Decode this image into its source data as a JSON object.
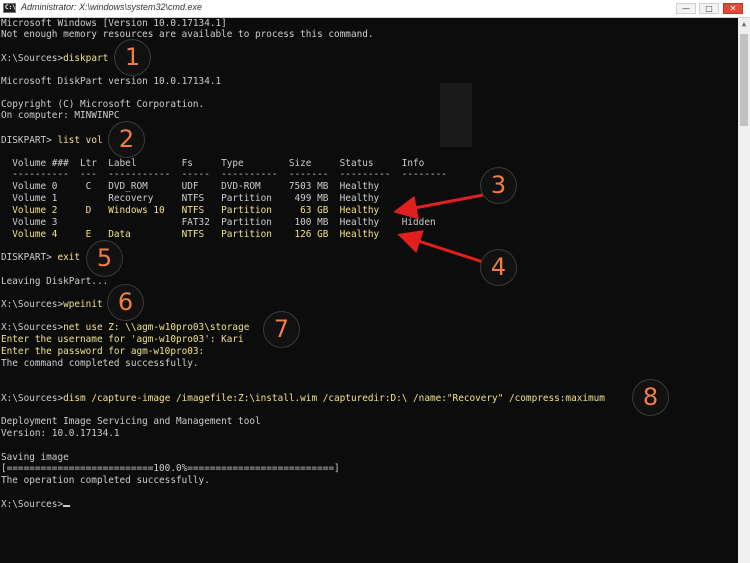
{
  "window": {
    "title": "Administrator: X:\\windows\\system32\\cmd.exe",
    "icon_label": "C:\\",
    "buttons": [
      "minimize",
      "maximize",
      "close"
    ]
  },
  "console": {
    "lines": {
      "l1": "Microsoft Windows [Version 10.0.17134.1]",
      "l2": "Not enough memory resources are available to process this command.",
      "prompt1": "X:\\Sources>",
      "cmd1": "diskpart",
      "l4": "Microsoft DiskPart version 10.0.17134.1",
      "l5": "Copyright (C) Microsoft Corporation.",
      "l6": "On computer: MINWINPC",
      "prompt2": "DISKPART> ",
      "cmd2": "list vol",
      "th": "  Volume ###  Ltr  Label        Fs     Type        Size     Status     Info",
      "tsep": "  ----------  ---  -----------  -----  ----------  -------  ---------  --------",
      "v0": "  Volume 0     C   DVD_ROM      UDF    DVD-ROM     7503 MB  Healthy",
      "v1": "  Volume 1         Recovery     NTFS   Partition    499 MB  Healthy",
      "v2": "  Volume 2     D   Windows 10   NTFS   Partition     63 GB  Healthy",
      "v3": "  Volume 3                      FAT32  Partition    100 MB  Healthy    Hidden",
      "v4": "  Volume 4     E   Data         NTFS   Partition    126 GB  Healthy",
      "prompt3": "DISKPART> ",
      "cmd3": "exit",
      "l7": "Leaving DiskPart...",
      "prompt4": "X:\\Sources>",
      "cmd4": "wpeinit",
      "prompt5": "X:\\Sources>",
      "cmd5": "net use Z: \\\\agm-w10pro03\\storage",
      "l8": "Enter the username for 'agm-w10pro03': Kari",
      "l9": "Enter the password for agm-w10pro03:",
      "l10": "The command completed successfully.",
      "prompt6": "X:\\Sources>",
      "cmd6": "dism /capture-image /imagefile:Z:\\install.wim /capturedir:D:\\ /name:\"Recovery\" /compress:maximum",
      "l11": "Deployment Image Servicing and Management tool",
      "l12": "Version: 10.0.17134.1",
      "l13": "Saving image",
      "l14": "[==========================100.0%==========================]",
      "l15": "The operation completed successfully.",
      "prompt7": "X:\\Sources>"
    }
  },
  "annotations": {
    "badges": [
      "1",
      "2",
      "3",
      "4",
      "5",
      "6",
      "7",
      "8"
    ],
    "accent_color": "#f07d45",
    "arrow_color": "#e0201e"
  },
  "colors": {
    "background": "#0c0c0c",
    "text": "#cccccc",
    "command_text": "#f0e08a"
  }
}
